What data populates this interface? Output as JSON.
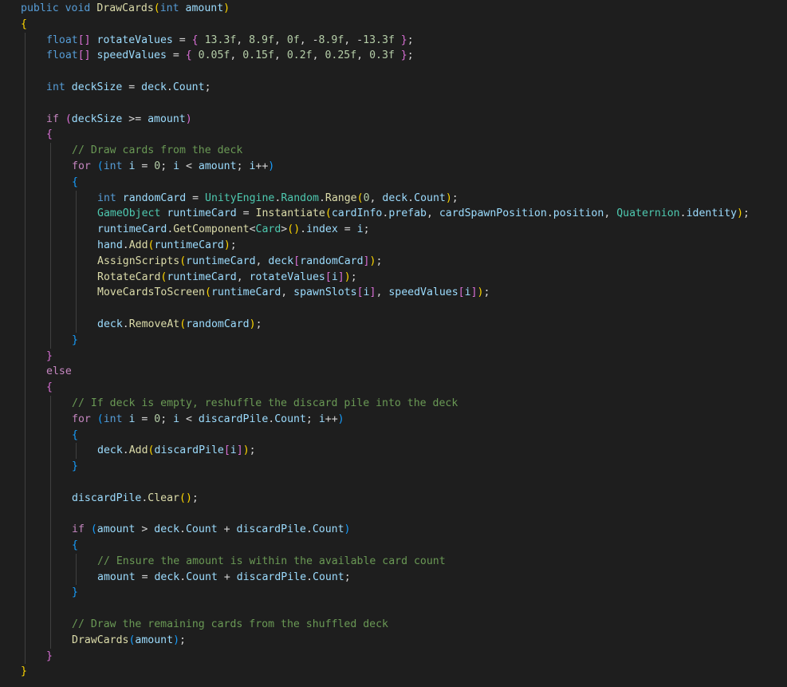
{
  "editor": {
    "language": "csharp",
    "theme": "dark",
    "colors": {
      "background": "#1e1e1e",
      "keyword": "#569cd6",
      "control": "#c586c0",
      "function": "#dcdcaa",
      "identifier": "#9cdcfe",
      "type": "#4ec9b0",
      "number": "#b5cea8",
      "comment": "#6a9955",
      "text": "#d4d4d4",
      "bracket_1": "#ffd700",
      "bracket_2": "#da70d6",
      "bracket_3": "#179fff"
    },
    "lines": [
      {
        "indent": 0,
        "tokens": [
          [
            "kw",
            "public"
          ],
          [
            "txt",
            " "
          ],
          [
            "kw",
            "void"
          ],
          [
            "txt",
            " "
          ],
          [
            "fn",
            "DrawCards"
          ],
          [
            "b1",
            "("
          ],
          [
            "kw",
            "int"
          ],
          [
            "txt",
            " "
          ],
          [
            "id",
            "amount"
          ],
          [
            "b1",
            ")"
          ]
        ]
      },
      {
        "indent": 0,
        "tokens": [
          [
            "b1",
            "{"
          ]
        ]
      },
      {
        "indent": 1,
        "tokens": [
          [
            "kw",
            "float"
          ],
          [
            "b2",
            "[]"
          ],
          [
            "txt",
            " "
          ],
          [
            "id",
            "rotateValues"
          ],
          [
            "txt",
            " = "
          ],
          [
            "b2",
            "{"
          ],
          [
            "txt",
            " "
          ],
          [
            "num",
            "13.3f"
          ],
          [
            "txt",
            ", "
          ],
          [
            "num",
            "8.9f"
          ],
          [
            "txt",
            ", "
          ],
          [
            "num",
            "0f"
          ],
          [
            "txt",
            ", -"
          ],
          [
            "num",
            "8.9f"
          ],
          [
            "txt",
            ", -"
          ],
          [
            "num",
            "13.3f"
          ],
          [
            "txt",
            " "
          ],
          [
            "b2",
            "}"
          ],
          [
            "txt",
            ";"
          ]
        ]
      },
      {
        "indent": 1,
        "tokens": [
          [
            "kw",
            "float"
          ],
          [
            "b2",
            "[]"
          ],
          [
            "txt",
            " "
          ],
          [
            "id",
            "speedValues"
          ],
          [
            "txt",
            " = "
          ],
          [
            "b2",
            "{"
          ],
          [
            "txt",
            " "
          ],
          [
            "num",
            "0.05f"
          ],
          [
            "txt",
            ", "
          ],
          [
            "num",
            "0.15f"
          ],
          [
            "txt",
            ", "
          ],
          [
            "num",
            "0.2f"
          ],
          [
            "txt",
            ", "
          ],
          [
            "num",
            "0.25f"
          ],
          [
            "txt",
            ", "
          ],
          [
            "num",
            "0.3f"
          ],
          [
            "txt",
            " "
          ],
          [
            "b2",
            "}"
          ],
          [
            "txt",
            ";"
          ]
        ]
      },
      {
        "indent": 1,
        "tokens": []
      },
      {
        "indent": 1,
        "tokens": [
          [
            "kw",
            "int"
          ],
          [
            "txt",
            " "
          ],
          [
            "id",
            "deckSize"
          ],
          [
            "txt",
            " = "
          ],
          [
            "id",
            "deck"
          ],
          [
            "txt",
            "."
          ],
          [
            "id",
            "Count"
          ],
          [
            "txt",
            ";"
          ]
        ]
      },
      {
        "indent": 1,
        "tokens": []
      },
      {
        "indent": 1,
        "tokens": [
          [
            "ctl",
            "if"
          ],
          [
            "txt",
            " "
          ],
          [
            "b2",
            "("
          ],
          [
            "id",
            "deckSize"
          ],
          [
            "txt",
            " >= "
          ],
          [
            "id",
            "amount"
          ],
          [
            "b2",
            ")"
          ]
        ]
      },
      {
        "indent": 1,
        "tokens": [
          [
            "b2",
            "{"
          ]
        ]
      },
      {
        "indent": 2,
        "tokens": [
          [
            "cmt",
            "// Draw cards from the deck"
          ]
        ]
      },
      {
        "indent": 2,
        "tokens": [
          [
            "ctl",
            "for"
          ],
          [
            "txt",
            " "
          ],
          [
            "b3",
            "("
          ],
          [
            "kw",
            "int"
          ],
          [
            "txt",
            " "
          ],
          [
            "id",
            "i"
          ],
          [
            "txt",
            " = "
          ],
          [
            "num",
            "0"
          ],
          [
            "txt",
            "; "
          ],
          [
            "id",
            "i"
          ],
          [
            "txt",
            " < "
          ],
          [
            "id",
            "amount"
          ],
          [
            "txt",
            "; "
          ],
          [
            "id",
            "i"
          ],
          [
            "txt",
            "++"
          ],
          [
            "b3",
            ")"
          ]
        ]
      },
      {
        "indent": 2,
        "tokens": [
          [
            "b3",
            "{"
          ]
        ]
      },
      {
        "indent": 3,
        "tokens": [
          [
            "kw",
            "int"
          ],
          [
            "txt",
            " "
          ],
          [
            "id",
            "randomCard"
          ],
          [
            "txt",
            " = "
          ],
          [
            "type",
            "UnityEngine"
          ],
          [
            "txt",
            "."
          ],
          [
            "type",
            "Random"
          ],
          [
            "txt",
            "."
          ],
          [
            "fn",
            "Range"
          ],
          [
            "b1",
            "("
          ],
          [
            "num",
            "0"
          ],
          [
            "txt",
            ", "
          ],
          [
            "id",
            "deck"
          ],
          [
            "txt",
            "."
          ],
          [
            "id",
            "Count"
          ],
          [
            "b1",
            ")"
          ],
          [
            "txt",
            ";"
          ]
        ]
      },
      {
        "indent": 3,
        "tokens": [
          [
            "type",
            "GameObject"
          ],
          [
            "txt",
            " "
          ],
          [
            "id",
            "runtimeCard"
          ],
          [
            "txt",
            " = "
          ],
          [
            "fn",
            "Instantiate"
          ],
          [
            "b1",
            "("
          ],
          [
            "id",
            "cardInfo"
          ],
          [
            "txt",
            "."
          ],
          [
            "id",
            "prefab"
          ],
          [
            "txt",
            ", "
          ],
          [
            "id",
            "cardSpawnPosition"
          ],
          [
            "txt",
            "."
          ],
          [
            "id",
            "position"
          ],
          [
            "txt",
            ", "
          ],
          [
            "type",
            "Quaternion"
          ],
          [
            "txt",
            "."
          ],
          [
            "id",
            "identity"
          ],
          [
            "b1",
            ")"
          ],
          [
            "txt",
            ";"
          ]
        ]
      },
      {
        "indent": 3,
        "tokens": [
          [
            "id",
            "runtimeCard"
          ],
          [
            "txt",
            "."
          ],
          [
            "fn",
            "GetComponent"
          ],
          [
            "txt",
            "<"
          ],
          [
            "type",
            "Card"
          ],
          [
            "txt",
            ">"
          ],
          [
            "b1",
            "()"
          ],
          [
            "txt",
            "."
          ],
          [
            "id",
            "index"
          ],
          [
            "txt",
            " = "
          ],
          [
            "id",
            "i"
          ],
          [
            "txt",
            ";"
          ]
        ]
      },
      {
        "indent": 3,
        "tokens": [
          [
            "id",
            "hand"
          ],
          [
            "txt",
            "."
          ],
          [
            "fn",
            "Add"
          ],
          [
            "b1",
            "("
          ],
          [
            "id",
            "runtimeCard"
          ],
          [
            "b1",
            ")"
          ],
          [
            "txt",
            ";"
          ]
        ]
      },
      {
        "indent": 3,
        "tokens": [
          [
            "fn",
            "AssignScripts"
          ],
          [
            "b1",
            "("
          ],
          [
            "id",
            "runtimeCard"
          ],
          [
            "txt",
            ", "
          ],
          [
            "id",
            "deck"
          ],
          [
            "b2",
            "["
          ],
          [
            "id",
            "randomCard"
          ],
          [
            "b2",
            "]"
          ],
          [
            "b1",
            ")"
          ],
          [
            "txt",
            ";"
          ]
        ]
      },
      {
        "indent": 3,
        "tokens": [
          [
            "fn",
            "RotateCard"
          ],
          [
            "b1",
            "("
          ],
          [
            "id",
            "runtimeCard"
          ],
          [
            "txt",
            ", "
          ],
          [
            "id",
            "rotateValues"
          ],
          [
            "b2",
            "["
          ],
          [
            "id",
            "i"
          ],
          [
            "b2",
            "]"
          ],
          [
            "b1",
            ")"
          ],
          [
            "txt",
            ";"
          ]
        ]
      },
      {
        "indent": 3,
        "tokens": [
          [
            "fn",
            "MoveCardsToScreen"
          ],
          [
            "b1",
            "("
          ],
          [
            "id",
            "runtimeCard"
          ],
          [
            "txt",
            ", "
          ],
          [
            "id",
            "spawnSlots"
          ],
          [
            "b2",
            "["
          ],
          [
            "id",
            "i"
          ],
          [
            "b2",
            "]"
          ],
          [
            "txt",
            ", "
          ],
          [
            "id",
            "speedValues"
          ],
          [
            "b2",
            "["
          ],
          [
            "id",
            "i"
          ],
          [
            "b2",
            "]"
          ],
          [
            "b1",
            ")"
          ],
          [
            "txt",
            ";"
          ]
        ]
      },
      {
        "indent": 3,
        "tokens": []
      },
      {
        "indent": 3,
        "tokens": [
          [
            "id",
            "deck"
          ],
          [
            "txt",
            "."
          ],
          [
            "fn",
            "RemoveAt"
          ],
          [
            "b1",
            "("
          ],
          [
            "id",
            "randomCard"
          ],
          [
            "b1",
            ")"
          ],
          [
            "txt",
            ";"
          ]
        ]
      },
      {
        "indent": 2,
        "tokens": [
          [
            "b3",
            "}"
          ]
        ]
      },
      {
        "indent": 1,
        "tokens": [
          [
            "b2",
            "}"
          ]
        ]
      },
      {
        "indent": 1,
        "tokens": [
          [
            "ctl",
            "else"
          ]
        ]
      },
      {
        "indent": 1,
        "tokens": [
          [
            "b2",
            "{"
          ]
        ]
      },
      {
        "indent": 2,
        "tokens": [
          [
            "cmt",
            "// If deck is empty, reshuffle the discard pile into the deck"
          ]
        ]
      },
      {
        "indent": 2,
        "tokens": [
          [
            "ctl",
            "for"
          ],
          [
            "txt",
            " "
          ],
          [
            "b3",
            "("
          ],
          [
            "kw",
            "int"
          ],
          [
            "txt",
            " "
          ],
          [
            "id",
            "i"
          ],
          [
            "txt",
            " = "
          ],
          [
            "num",
            "0"
          ],
          [
            "txt",
            "; "
          ],
          [
            "id",
            "i"
          ],
          [
            "txt",
            " < "
          ],
          [
            "id",
            "discardPile"
          ],
          [
            "txt",
            "."
          ],
          [
            "id",
            "Count"
          ],
          [
            "txt",
            "; "
          ],
          [
            "id",
            "i"
          ],
          [
            "txt",
            "++"
          ],
          [
            "b3",
            ")"
          ]
        ]
      },
      {
        "indent": 2,
        "tokens": [
          [
            "b3",
            "{"
          ]
        ]
      },
      {
        "indent": 3,
        "tokens": [
          [
            "id",
            "deck"
          ],
          [
            "txt",
            "."
          ],
          [
            "fn",
            "Add"
          ],
          [
            "b1",
            "("
          ],
          [
            "id",
            "discardPile"
          ],
          [
            "b2",
            "["
          ],
          [
            "id",
            "i"
          ],
          [
            "b2",
            "]"
          ],
          [
            "b1",
            ")"
          ],
          [
            "txt",
            ";"
          ]
        ]
      },
      {
        "indent": 2,
        "tokens": [
          [
            "b3",
            "}"
          ]
        ]
      },
      {
        "indent": 2,
        "tokens": []
      },
      {
        "indent": 2,
        "tokens": [
          [
            "id",
            "discardPile"
          ],
          [
            "txt",
            "."
          ],
          [
            "fn",
            "Clear"
          ],
          [
            "b1",
            "()"
          ],
          [
            "txt",
            ";"
          ]
        ]
      },
      {
        "indent": 2,
        "tokens": []
      },
      {
        "indent": 2,
        "tokens": [
          [
            "ctl",
            "if"
          ],
          [
            "txt",
            " "
          ],
          [
            "b3",
            "("
          ],
          [
            "id",
            "amount"
          ],
          [
            "txt",
            " > "
          ],
          [
            "id",
            "deck"
          ],
          [
            "txt",
            "."
          ],
          [
            "id",
            "Count"
          ],
          [
            "txt",
            " + "
          ],
          [
            "id",
            "discardPile"
          ],
          [
            "txt",
            "."
          ],
          [
            "id",
            "Count"
          ],
          [
            "b3",
            ")"
          ]
        ]
      },
      {
        "indent": 2,
        "tokens": [
          [
            "b3",
            "{"
          ]
        ]
      },
      {
        "indent": 3,
        "tokens": [
          [
            "cmt",
            "// Ensure the amount is within the available card count"
          ]
        ]
      },
      {
        "indent": 3,
        "tokens": [
          [
            "id",
            "amount"
          ],
          [
            "txt",
            " = "
          ],
          [
            "id",
            "deck"
          ],
          [
            "txt",
            "."
          ],
          [
            "id",
            "Count"
          ],
          [
            "txt",
            " + "
          ],
          [
            "id",
            "discardPile"
          ],
          [
            "txt",
            "."
          ],
          [
            "id",
            "Count"
          ],
          [
            "txt",
            ";"
          ]
        ]
      },
      {
        "indent": 2,
        "tokens": [
          [
            "b3",
            "}"
          ]
        ]
      },
      {
        "indent": 2,
        "tokens": []
      },
      {
        "indent": 2,
        "tokens": [
          [
            "cmt",
            "// Draw the remaining cards from the shuffled deck"
          ]
        ]
      },
      {
        "indent": 2,
        "tokens": [
          [
            "fn",
            "DrawCards"
          ],
          [
            "b3",
            "("
          ],
          [
            "id",
            "amount"
          ],
          [
            "b3",
            ")"
          ],
          [
            "txt",
            ";"
          ]
        ]
      },
      {
        "indent": 1,
        "tokens": [
          [
            "b2",
            "}"
          ]
        ]
      },
      {
        "indent": 0,
        "tokens": [
          [
            "b1",
            "}"
          ]
        ]
      }
    ]
  }
}
